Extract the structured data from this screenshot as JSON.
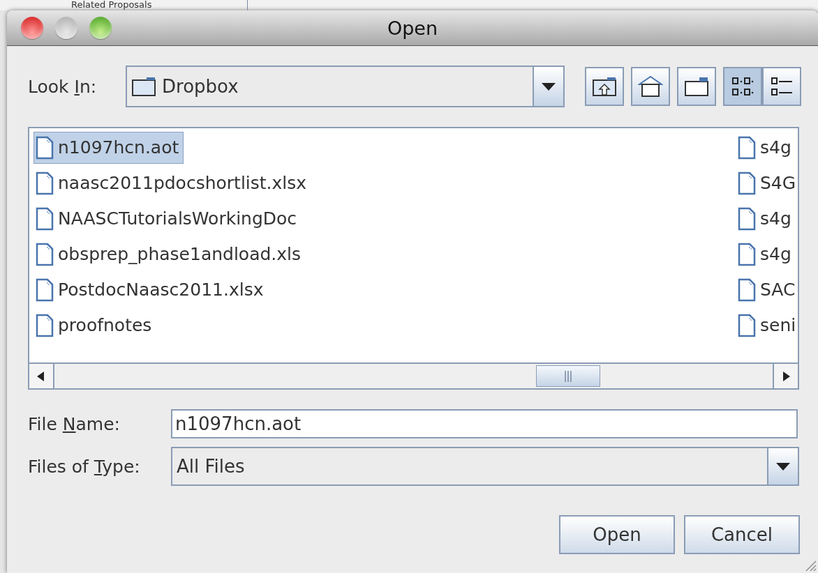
{
  "background": {
    "tab": "Related Proposals"
  },
  "window": {
    "title": "Open"
  },
  "look_in": {
    "label": {
      "before": "Look ",
      "key": "I",
      "after": "n:"
    },
    "value": "Dropbox"
  },
  "toolbar": [
    {
      "kind": "up"
    },
    {
      "kind": "home"
    },
    {
      "kind": "new-folder"
    },
    {
      "kind": "list",
      "selected": true
    },
    {
      "kind": "details",
      "selected": false
    }
  ],
  "files": [
    [
      {
        "name": "n1097hcn.aot",
        "selected": true
      },
      {
        "name": "naasc2011pdocshortlist.xlsx",
        "selected": false
      },
      {
        "name": "NAASCTutorialsWorkingDoc",
        "selected": false
      },
      {
        "name": "obsprep_phase1andload.xls",
        "selected": false
      },
      {
        "name": "PostdocNaasc2011.xlsx",
        "selected": false
      },
      {
        "name": "proofnotes",
        "selected": false
      }
    ],
    [
      {
        "name": "s4g",
        "selected": false
      },
      {
        "name": "S4G",
        "selected": false
      },
      {
        "name": "s4g",
        "selected": false
      },
      {
        "name": "s4g",
        "selected": false
      },
      {
        "name": "SAC",
        "selected": false
      },
      {
        "name": "seni",
        "selected": false
      }
    ]
  ],
  "file_name": {
    "label": {
      "before": "File ",
      "key": "N",
      "after": "ame:"
    },
    "value": "n1097hcn.aot"
  },
  "files_of_type": {
    "label": {
      "before": "Files of ",
      "key": "T",
      "after": "ype:"
    },
    "value": "All Files"
  },
  "buttons": [
    "Open",
    "Cancel"
  ]
}
